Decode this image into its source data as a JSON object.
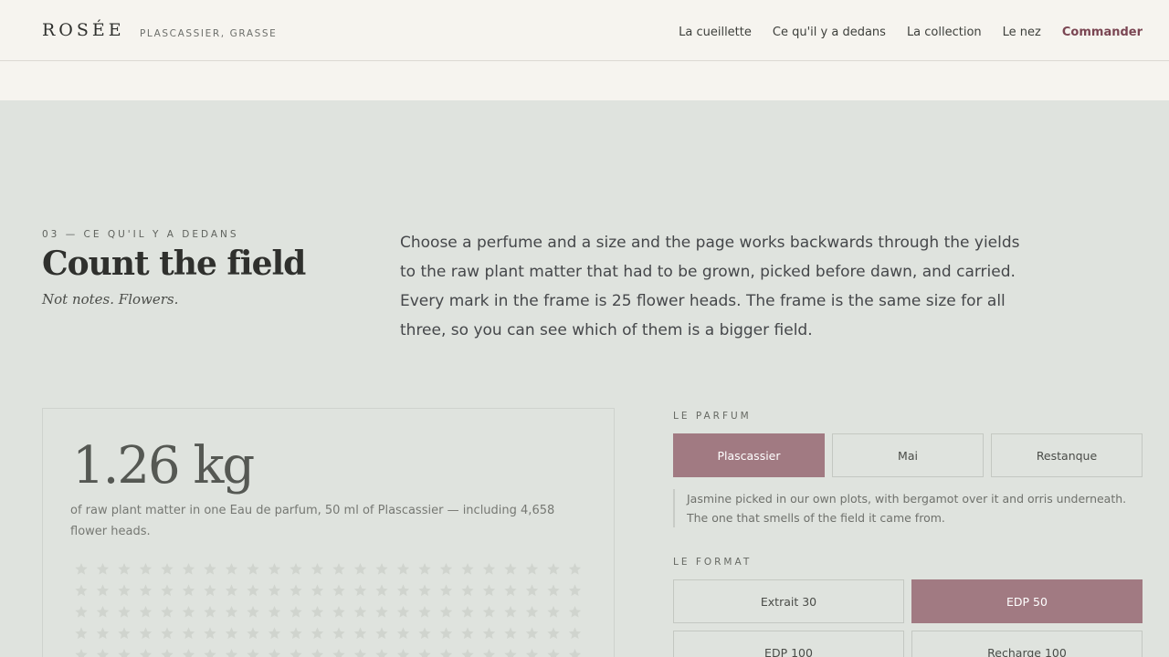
{
  "header": {
    "brand": "ROSÉE",
    "location": "PLASCASSIER, GRASSE",
    "nav": [
      {
        "label": "La cueillette"
      },
      {
        "label": "Ce qu'il y a dedans"
      },
      {
        "label": "La collection"
      },
      {
        "label": "Le nez"
      },
      {
        "label": "Commander"
      }
    ]
  },
  "section": {
    "eyebrow": "03 — CE QU'IL Y A DEDANS",
    "title": "Count the field",
    "subtitle": "Not notes. Flowers.",
    "intro": "Choose a perfume and a size and the page works backwards through the yields to the raw plant matter that had to be grown, picked before dawn, and carried. Every mark in the frame is 25 flower heads. The frame is the same size for all three, so you can see which of them is a bigger field."
  },
  "result": {
    "weight": "1.26 kg",
    "caption": "of raw plant matter in one Eau de parfum, 50 ml of Plascassier — including 4,658 flower heads."
  },
  "parfum": {
    "label": "LE PARFUM",
    "options": [
      {
        "label": "Plascassier",
        "active": true
      },
      {
        "label": "Mai",
        "active": false
      },
      {
        "label": "Restanque",
        "active": false
      }
    ],
    "description": "Jasmine picked in our own plots, with bergamot over it and orris underneath. The one that smells of the field it came from."
  },
  "format": {
    "label": "LE FORMAT",
    "options": [
      {
        "label": "Extrait 30",
        "active": false
      },
      {
        "label": "EDP 50",
        "active": true
      },
      {
        "label": "EDP 100",
        "active": false
      },
      {
        "label": "Recharge 100",
        "active": false
      }
    ]
  },
  "colors": {
    "accent": "#a17a82",
    "commander": "#7a4552",
    "mark": "#d0d4ce"
  },
  "icons": {
    "flower_mark": "star-icon"
  }
}
